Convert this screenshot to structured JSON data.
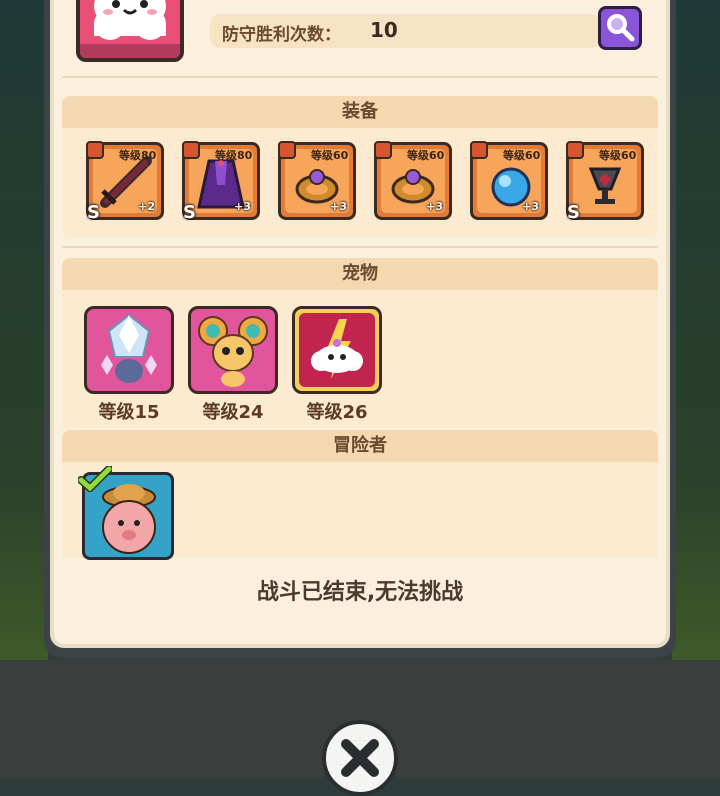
{
  "profile": {
    "defense_label": "防守胜利次数：",
    "defense_value": "10"
  },
  "equipment": {
    "title": "装备",
    "items": [
      {
        "level": "等级80",
        "plus": "+2",
        "grade": "S",
        "icon": "sword-icon"
      },
      {
        "level": "等级80",
        "plus": "+3",
        "grade": "S",
        "icon": "cloak-icon"
      },
      {
        "level": "等级60",
        "plus": "+3",
        "grade": "",
        "icon": "ring-icon"
      },
      {
        "level": "等级60",
        "plus": "+3",
        "grade": "",
        "icon": "ring-icon"
      },
      {
        "level": "等级60",
        "plus": "+3",
        "grade": "",
        "icon": "crystal-orb-icon"
      },
      {
        "level": "等级60",
        "plus": "",
        "grade": "S",
        "icon": "goblet-icon"
      }
    ]
  },
  "pets": {
    "title": "宠物",
    "items": [
      {
        "level": "等级15",
        "icon": "ice-crystal-pet-icon"
      },
      {
        "level": "等级24",
        "icon": "mouse-pet-icon"
      },
      {
        "level": "等级26",
        "icon": "cloud-pet-icon"
      }
    ]
  },
  "adventurers": {
    "title": "冒险者",
    "items": [
      {
        "icon": "pig-adventurer-icon",
        "selected": true
      }
    ]
  },
  "battle_message": "战斗已结束,无法挑战",
  "colors": {
    "panel_bg": "#fbf0dd",
    "section_header": "#f2d9b2",
    "equip_orange": "#e17b37",
    "search_purple": "#8a55d8",
    "text_brown": "#6b4a2f"
  }
}
